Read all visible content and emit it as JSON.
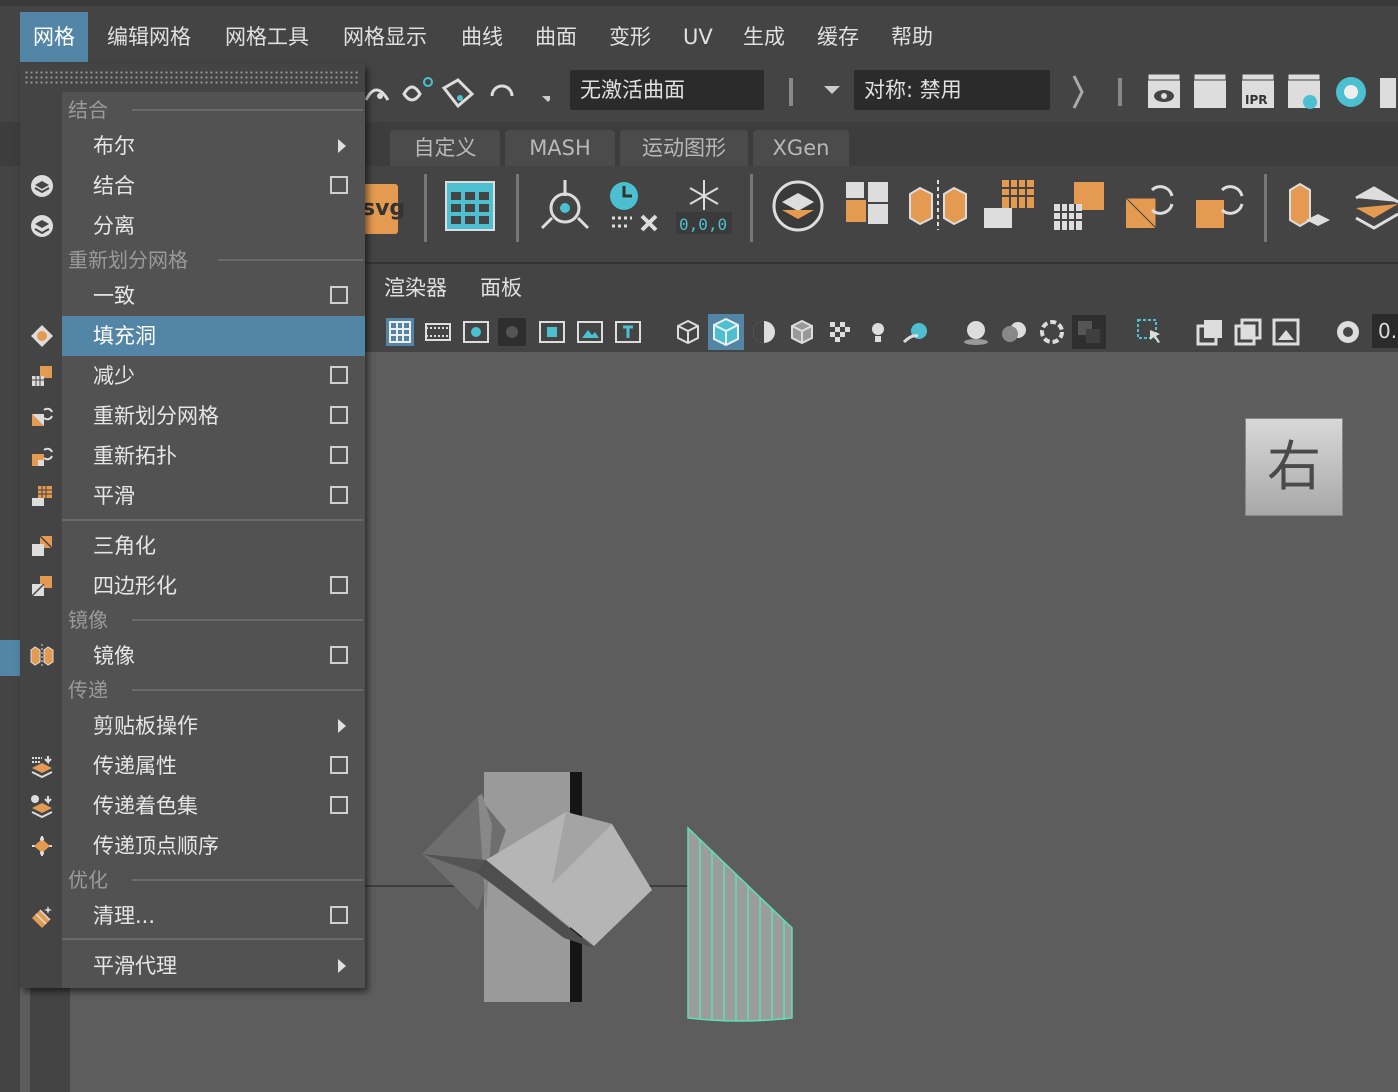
{
  "menubar": {
    "items": [
      "网格",
      "编辑网格",
      "网格工具",
      "网格显示",
      "曲线",
      "曲面",
      "变形",
      "UV",
      "生成",
      "缓存",
      "帮助"
    ]
  },
  "status": {
    "live_surface": "无激活曲面",
    "symmetry": "对称: 禁用",
    "ipr_label": "IPR"
  },
  "shelf": {
    "tabs": [
      "自定义",
      "MASH",
      "运动图形",
      "XGen"
    ],
    "svg_label": "svg",
    "freeze_label": "0,0,0"
  },
  "panel": {
    "menus": [
      "渲染器",
      "面板"
    ],
    "field_value": "0."
  },
  "dropdown": {
    "sections": {
      "combine": "结合",
      "remesh": "重新划分网格",
      "mirror": "镜像",
      "transfer": "传递",
      "optimize": "优化"
    },
    "items": [
      {
        "label": "布尔"
      },
      {
        "label": "结合"
      },
      {
        "label": "分离"
      },
      {
        "label": "一致"
      },
      {
        "label": "填充洞"
      },
      {
        "label": "减少"
      },
      {
        "label": "重新划分网格"
      },
      {
        "label": "重新拓扑"
      },
      {
        "label": "平滑"
      },
      {
        "label": "三角化"
      },
      {
        "label": "四边形化"
      },
      {
        "label": "镜像"
      },
      {
        "label": "剪贴板操作"
      },
      {
        "label": "传递属性"
      },
      {
        "label": "传递着色集"
      },
      {
        "label": "传递顶点顺序"
      },
      {
        "label": "清理..."
      },
      {
        "label": "平滑代理"
      }
    ]
  },
  "viewport": {
    "viewcube_label": "右"
  },
  "colors": {
    "accent": "#5285a6",
    "orange": "#e49a50",
    "teal": "#4cc0d0",
    "selection_green": "#5ee0b0"
  }
}
